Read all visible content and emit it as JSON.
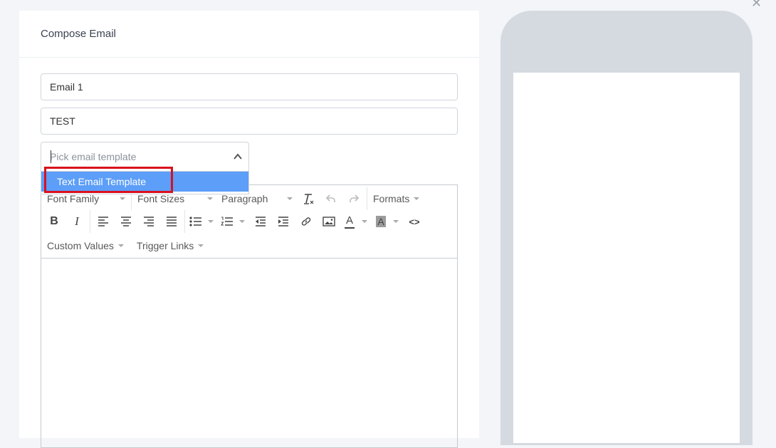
{
  "modal": {
    "title": "Compose Email"
  },
  "form": {
    "name_value": "Email 1",
    "subject_value": "TEST",
    "template_placeholder": "Pick email template",
    "template_options": [
      "Text Email Template"
    ]
  },
  "toolbar": {
    "font_family": "Font Family",
    "font_sizes": "Font Sizes",
    "paragraph": "Paragraph",
    "formats": "Formats",
    "custom_values": "Custom Values",
    "trigger_links": "Trigger Links",
    "bold_glyph": "B",
    "italic_glyph": "I",
    "text_color_glyph": "A",
    "bg_color_glyph": "A",
    "code_glyph": "<>"
  },
  "icons": [
    "close-icon",
    "chevron-up-icon",
    "clear-format-icon",
    "undo-icon",
    "redo-icon",
    "bold-icon",
    "italic-icon",
    "align-left-icon",
    "align-center-icon",
    "align-right-icon",
    "align-justify-icon",
    "bullet-list-icon",
    "numbered-list-icon",
    "outdent-icon",
    "indent-icon",
    "link-icon",
    "image-icon",
    "text-color-icon",
    "background-color-icon",
    "source-code-icon"
  ],
  "colors": {
    "highlight_border": "#d9101c",
    "selected_option": "#5c9ef8",
    "phone_frame": "#d5dae1"
  }
}
